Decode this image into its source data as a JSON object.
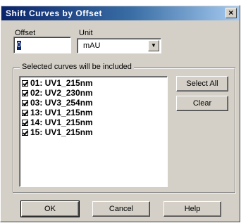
{
  "dialog": {
    "title": "Shift Curves by Offset",
    "close_glyph": "×"
  },
  "offset": {
    "label": "Offset",
    "value": "0"
  },
  "unit": {
    "label": "Unit",
    "value": "mAU"
  },
  "group": {
    "label": "Selected curves will be included",
    "curves": [
      {
        "label": "01: UV1_215nm",
        "checked": true
      },
      {
        "label": "02: UV2_230nm",
        "checked": true
      },
      {
        "label": "03: UV3_254nm",
        "checked": true
      },
      {
        "label": "13: UV1_215nm",
        "checked": true
      },
      {
        "label": "14: UV1_215nm",
        "checked": true
      },
      {
        "label": "15: UV1_215nm",
        "checked": true
      }
    ]
  },
  "buttons": {
    "select_all": "Select All",
    "clear": "Clear",
    "ok": "OK",
    "cancel": "Cancel",
    "help": "Help"
  }
}
